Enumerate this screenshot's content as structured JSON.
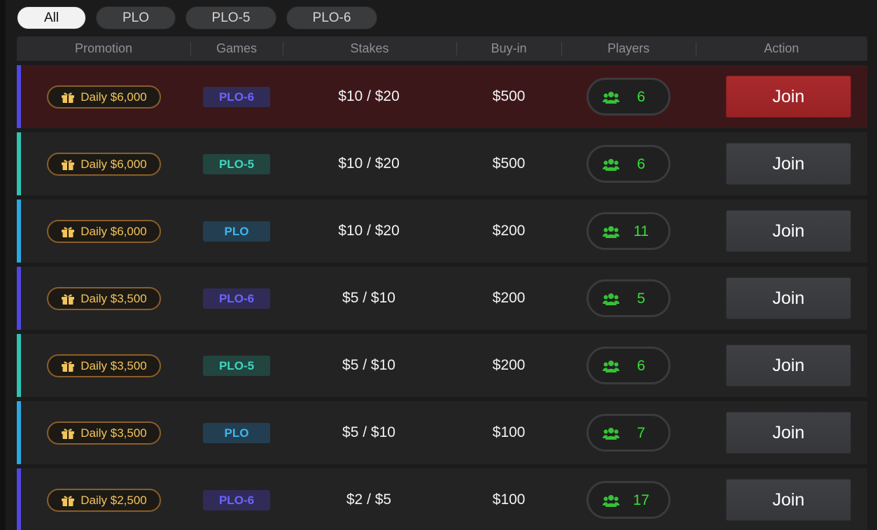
{
  "filters": [
    {
      "label": "All",
      "active": true
    },
    {
      "label": "PLO",
      "active": false
    },
    {
      "label": "PLO-5",
      "active": false
    },
    {
      "label": "PLO-6",
      "active": false
    }
  ],
  "header": {
    "promotion": "Promotion",
    "games": "Games",
    "stakes": "Stakes",
    "buyin": "Buy-in",
    "players": "Players",
    "action": "Action"
  },
  "colors": {
    "PLO-6": {
      "accent": "#5146e6",
      "text": "#6d63ff",
      "bg": "#302c57"
    },
    "PLO-5": {
      "accent": "#2ec4b0",
      "text": "#3fd6c0",
      "bg": "#22453f"
    },
    "PLO": {
      "accent": "#2aa8e0",
      "text": "#3bb7ef",
      "bg": "#233e50"
    }
  },
  "rows": [
    {
      "promotion": "Daily $6,000",
      "game": "PLO-6",
      "stakes": "$10 / $20",
      "buyin": "$500",
      "players": "6",
      "action": "Join",
      "highlight": true
    },
    {
      "promotion": "Daily $6,000",
      "game": "PLO-5",
      "stakes": "$10 / $20",
      "buyin": "$500",
      "players": "6",
      "action": "Join",
      "highlight": false
    },
    {
      "promotion": "Daily $6,000",
      "game": "PLO",
      "stakes": "$10 / $20",
      "buyin": "$200",
      "players": "11",
      "action": "Join",
      "highlight": false
    },
    {
      "promotion": "Daily $3,500",
      "game": "PLO-6",
      "stakes": "$5 / $10",
      "buyin": "$200",
      "players": "5",
      "action": "Join",
      "highlight": false
    },
    {
      "promotion": "Daily $3,500",
      "game": "PLO-5",
      "stakes": "$5 / $10",
      "buyin": "$200",
      "players": "6",
      "action": "Join",
      "highlight": false
    },
    {
      "promotion": "Daily $3,500",
      "game": "PLO",
      "stakes": "$5 / $10",
      "buyin": "$100",
      "players": "7",
      "action": "Join",
      "highlight": false
    },
    {
      "promotion": "Daily $2,500",
      "game": "PLO-6",
      "stakes": "$2 / $5",
      "buyin": "$100",
      "players": "17",
      "action": "Join",
      "highlight": false
    }
  ]
}
